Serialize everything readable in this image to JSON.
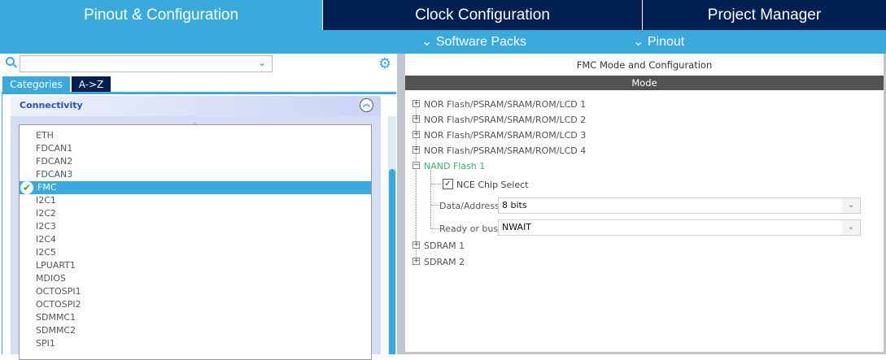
{
  "tabs": [
    {
      "label": "Pinout & Configuration"
    },
    {
      "label": "Clock Configuration"
    },
    {
      "label": "Project Manager"
    }
  ],
  "subnav": [
    {
      "label": "Software Packs"
    },
    {
      "label": "Pinout"
    }
  ],
  "left": {
    "search": {
      "value": "",
      "placeholder": ""
    },
    "view_tabs": [
      {
        "label": "Categories"
      },
      {
        "label": "A->Z"
      }
    ],
    "category": "Connectivity",
    "items": [
      "ETH",
      "FDCAN1",
      "FDCAN2",
      "FDCAN3",
      "FMC",
      "I2C1",
      "I2C2",
      "I2C3",
      "I2C4",
      "I2C5",
      "LPUART1",
      "MDIOS",
      "OCTOSPI1",
      "OCTOSPI2",
      "SDMMC1",
      "SDMMC2",
      "SPI1"
    ],
    "selected": "FMC"
  },
  "right": {
    "title": "FMC Mode and Configuration",
    "mode_header": "Mode",
    "tree": {
      "nor": [
        "NOR Flash/PSRAM/SRAM/ROM/LCD 1",
        "NOR Flash/PSRAM/SRAM/ROM/LCD 2",
        "NOR Flash/PSRAM/SRAM/ROM/LCD 3",
        "NOR Flash/PSRAM/SRAM/ROM/LCD 4"
      ],
      "nand": "NAND Flash 1",
      "nce_label": "NCE Chip Select",
      "nce_checked": true,
      "data_address_label": "Data/Address",
      "data_address_value": "8 bits",
      "ready_label": "Ready or busy",
      "ready_value": "NWAIT",
      "sdram": [
        "SDRAM 1",
        "SDRAM 2"
      ]
    }
  },
  "colors": {
    "accent": "#3aa9db",
    "navy": "#002052",
    "nand": "#3cb371"
  }
}
